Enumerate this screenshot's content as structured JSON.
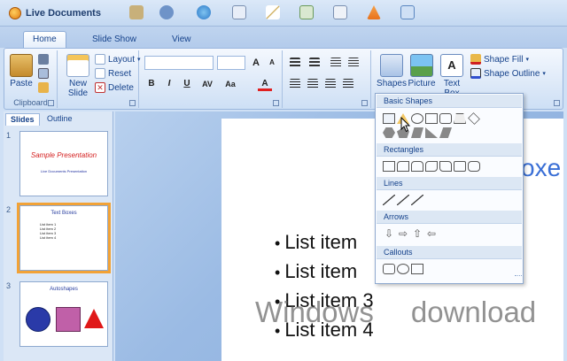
{
  "app": {
    "title": "Live Documents"
  },
  "tabs": [
    "Home",
    "Slide Show",
    "View"
  ],
  "ribbon": {
    "clipboard": {
      "label": "Clipboard",
      "paste": "Paste"
    },
    "slides": {
      "new_slide": "New\nSlide",
      "layout": "Layout",
      "reset": "Reset",
      "delete": "Delete"
    },
    "font": {
      "bold": "B",
      "italic": "I",
      "underline": "U",
      "spacing": "AV",
      "case": "Aa",
      "grow": "A",
      "shrink": "A"
    },
    "drawing": {
      "shapes": "Shapes",
      "picture": "Picture",
      "textbox": "Text\nBox",
      "shape_fill": "Shape Fill",
      "shape_outline": "Shape Outline"
    }
  },
  "panel": {
    "tab_slides": "Slides",
    "tab_outline": "Outline"
  },
  "thumbnails": [
    {
      "num": "1",
      "title": "Sample Presentation",
      "subtitle": "Live Documents Presentation"
    },
    {
      "num": "2",
      "title": "Text Boxes",
      "items": [
        "List item 1",
        "List item 2",
        "List item 3",
        "List item 4"
      ]
    },
    {
      "num": "3",
      "title": "Autoshapes"
    }
  ],
  "slide": {
    "title": "oxe",
    "bullets": [
      "List item",
      "List item",
      "List item 3",
      "List item 4"
    ]
  },
  "shapes_menu": {
    "sections": [
      "Basic Shapes",
      "Rectangles",
      "Lines",
      "Arrows",
      "Callouts"
    ]
  },
  "watermark": {
    "left": "Windows",
    "right": "download"
  },
  "colors": {
    "accent": "#15428b",
    "selection": "#f2a236",
    "title_blue": "#3a6fd6"
  }
}
